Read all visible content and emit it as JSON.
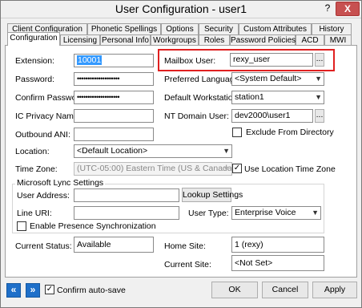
{
  "window": {
    "title": "User Configuration - user1",
    "help_label": "?",
    "close_label": "X"
  },
  "tabs": {
    "row1": [
      "Client Configuration",
      "Phonetic Spellings",
      "Options",
      "Security",
      "Custom Attributes",
      "History"
    ],
    "row2": [
      "Configuration",
      "Licensing",
      "Personal Info",
      "Workgroups",
      "Roles",
      "Password Policies",
      "ACD",
      "MWI"
    ],
    "active": "Configuration"
  },
  "left": {
    "extension_label": "Extension:",
    "extension_value": "10001",
    "password_label": "Password:",
    "password_value": "••••••••••••••••••••",
    "confirm_password_label": "Confirm Password:",
    "confirm_password_value": "••••••••••••••••••••",
    "ic_privacy_label": "IC Privacy Name:",
    "ic_privacy_value": "",
    "outbound_ani_label": "Outbound ANI:",
    "outbound_ani_value": ""
  },
  "right": {
    "mailbox_label": "Mailbox User:",
    "mailbox_value": "rexy_user",
    "browse_label": "...",
    "language_label": "Preferred Language:",
    "language_value": "<System Default>",
    "workstation_label": "Default Workstation:",
    "workstation_value": "station1",
    "nt_user_label": "NT Domain User:",
    "nt_user_value": "dev2000\\user1",
    "exclude_label": "Exclude From Directory",
    "exclude_checked": false
  },
  "location": {
    "location_label": "Location:",
    "location_value": "<Default Location>",
    "timezone_label": "Time Zone:",
    "timezone_value": "(UTC-05:00) Eastern Time (US & Canada)",
    "use_location_tz_label": "Use Location Time Zone",
    "use_location_tz_checked": true
  },
  "lync": {
    "group_title": "Microsoft Lync Settings",
    "user_address_label": "User Address:",
    "user_address_value": "",
    "lookup_label": "Lookup Settings",
    "line_uri_label": "Line URI:",
    "line_uri_value": "",
    "user_type_label": "User Type:",
    "user_type_value": "Enterprise Voice",
    "enable_presence_label": "Enable Presence Synchronization",
    "enable_presence_checked": false
  },
  "status": {
    "current_status_label": "Current Status:",
    "current_status_value": "Available",
    "home_site_label": "Home Site:",
    "home_site_value": "1 (rexy)",
    "current_site_label": "Current Site:",
    "current_site_value": "<Not Set>"
  },
  "footer": {
    "back_label": "«",
    "forward_label": "»",
    "confirm_autosave_label": "Confirm auto-save",
    "confirm_autosave_checked": true,
    "ok_label": "OK",
    "cancel_label": "Cancel",
    "apply_label": "Apply"
  },
  "checkmark": "✓",
  "colors": {
    "highlight": "#e02020",
    "nav_button": "#1e6fc9",
    "selection": "#3399ff"
  },
  "icons": {
    "dropdown": "▼"
  }
}
